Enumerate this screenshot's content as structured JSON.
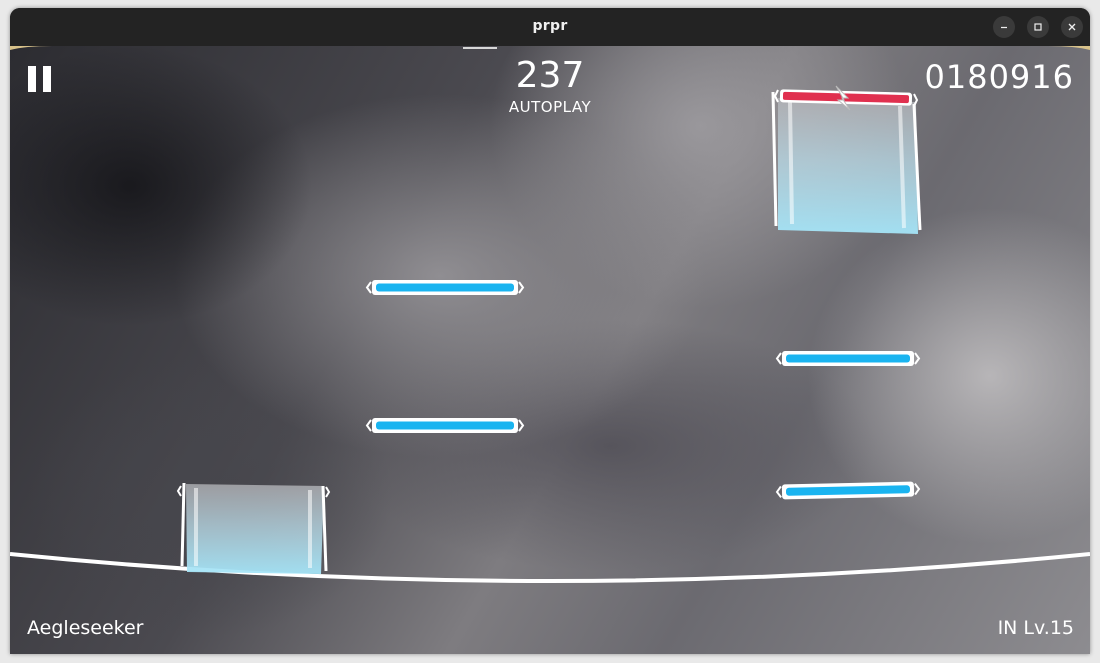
{
  "window": {
    "title": "prpr"
  },
  "hud": {
    "combo": "237",
    "combo_label": "AUTOPLAY",
    "score": "0180916",
    "song_name": "Aegleseeker",
    "difficulty": "IN Lv.15"
  },
  "colors": {
    "tap_note": "#1ab4f0",
    "flick_note": "#e0304f",
    "judge_line": "#ffffff",
    "hold_body": "#a9e4f6"
  },
  "icons": {
    "pause": "pause-icon",
    "minimize": "minimize-icon",
    "maximize": "maximize-icon",
    "close": "close-icon"
  }
}
